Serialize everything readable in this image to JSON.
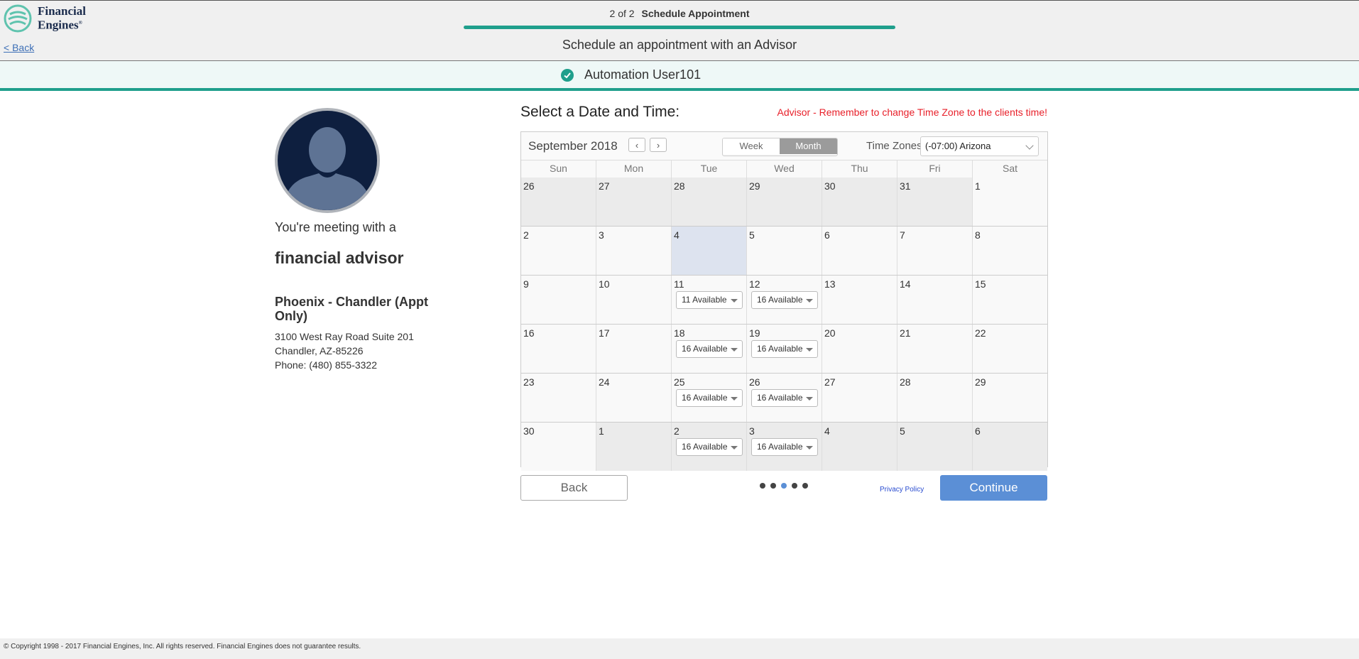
{
  "brand": {
    "name_line1": "Financial",
    "name_line2": "Engines",
    "reg": "®",
    "accent": "#1f9f8c"
  },
  "header": {
    "back_label": "< Back",
    "step": "2 of 2",
    "step_title": "Schedule Appointment",
    "progress_percent": 100,
    "subtitle": "Schedule an appointment with an Advisor"
  },
  "user": {
    "name": "Automation User101"
  },
  "advisor": {
    "meeting_text": "You're meeting with a",
    "role": "financial advisor",
    "office": "Phoenix - Chandler (Appt Only)",
    "address1": "3100 West Ray Road Suite 201",
    "address2": "Chandler, AZ-85226",
    "phone": "Phone: (480) 855-3322"
  },
  "calendar": {
    "title": "Select a Date and Time:",
    "reminder": "Advisor - Remember to change Time Zone to the clients time!",
    "month_label": "September 2018",
    "prev": "‹",
    "next": "›",
    "view_week": "Week",
    "view_month": "Month",
    "active_view": "Month",
    "tz_label": "Time Zones",
    "tz_value": "(-07:00) Arizona",
    "days": [
      "Sun",
      "Mon",
      "Tue",
      "Wed",
      "Thu",
      "Fri",
      "Sat"
    ],
    "weeks": [
      [
        {
          "d": "26",
          "muted": true
        },
        {
          "d": "27",
          "muted": true
        },
        {
          "d": "28",
          "muted": true
        },
        {
          "d": "29",
          "muted": true
        },
        {
          "d": "30",
          "muted": true
        },
        {
          "d": "31",
          "muted": true
        },
        {
          "d": "1"
        }
      ],
      [
        {
          "d": "2"
        },
        {
          "d": "3"
        },
        {
          "d": "4",
          "today": true
        },
        {
          "d": "5"
        },
        {
          "d": "6"
        },
        {
          "d": "7"
        },
        {
          "d": "8"
        }
      ],
      [
        {
          "d": "9"
        },
        {
          "d": "10"
        },
        {
          "d": "11",
          "avail": "11 Available"
        },
        {
          "d": "12",
          "avail": "16 Available"
        },
        {
          "d": "13"
        },
        {
          "d": "14"
        },
        {
          "d": "15"
        }
      ],
      [
        {
          "d": "16"
        },
        {
          "d": "17"
        },
        {
          "d": "18",
          "avail": "16 Available"
        },
        {
          "d": "19",
          "avail": "16 Available"
        },
        {
          "d": "20"
        },
        {
          "d": "21"
        },
        {
          "d": "22"
        }
      ],
      [
        {
          "d": "23"
        },
        {
          "d": "24"
        },
        {
          "d": "25",
          "avail": "16 Available"
        },
        {
          "d": "26",
          "avail": "16 Available"
        },
        {
          "d": "27"
        },
        {
          "d": "28"
        },
        {
          "d": "29"
        }
      ],
      [
        {
          "d": "30"
        },
        {
          "d": "1",
          "muted": true
        },
        {
          "d": "2",
          "muted": true,
          "avail": "16 Available"
        },
        {
          "d": "3",
          "muted": true,
          "avail": "16 Available"
        },
        {
          "d": "4",
          "muted": true
        },
        {
          "d": "5",
          "muted": true
        },
        {
          "d": "6",
          "muted": true
        }
      ]
    ]
  },
  "actions": {
    "back": "Back",
    "continue": "Continue",
    "privacy": "Privacy Policy",
    "pager_total": 5,
    "pager_active": 3
  },
  "footer": {
    "copyright": "© Copyright 1998 - 2017 Financial Engines, Inc. All rights reserved. Financial Engines does not guarantee results."
  }
}
